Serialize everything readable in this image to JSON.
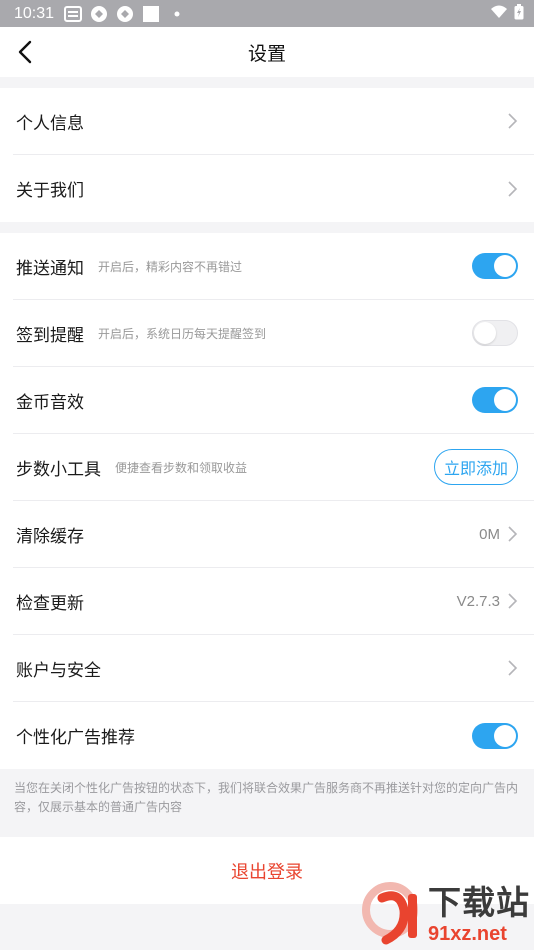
{
  "status_bar": {
    "time": "10:31"
  },
  "app_bar": {
    "title": "设置"
  },
  "group1": [
    {
      "label": "个人信息"
    },
    {
      "label": "关于我们"
    }
  ],
  "group2": [
    {
      "label": "推送通知",
      "hint": "开启后，精彩内容不再错过",
      "toggle": true
    },
    {
      "label": "签到提醒",
      "hint": "开启后，系统日历每天提醒签到",
      "toggle": false
    },
    {
      "label": "金币音效",
      "toggle": true
    },
    {
      "label": "步数小工具",
      "hint": "便捷查看步数和领取收益",
      "button": "立即添加"
    },
    {
      "label": "清除缓存",
      "value": "0M"
    },
    {
      "label": "检查更新",
      "value": "V2.7.3"
    },
    {
      "label": "账户与安全"
    },
    {
      "label": "个性化广告推荐",
      "toggle": true
    }
  ],
  "note": "当您在关闭个性化广告按钮的状态下，我们将联合效果广告服务商不再推送针对您的定向广告内容，仅展示基本的普通广告内容",
  "logout_label": "退出登录",
  "watermark": {
    "text": "下载站",
    "url": "91xz.net"
  },
  "colors": {
    "accent": "#2da5f0",
    "danger": "#e9442f",
    "status_bar": "#a9a9ad"
  }
}
